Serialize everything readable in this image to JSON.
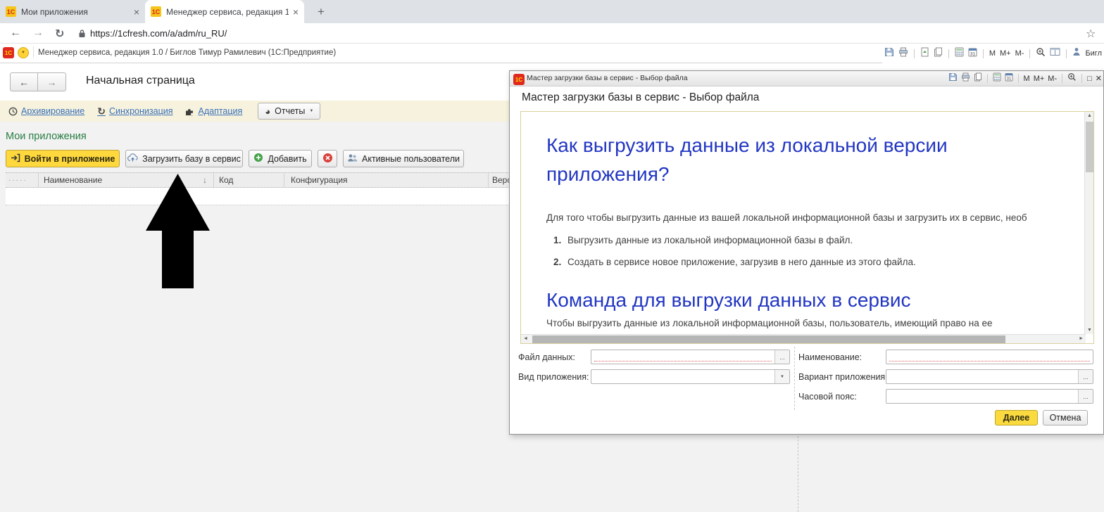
{
  "browser": {
    "tab1": "Мои приложения",
    "tab2": "Менеджер сервиса, редакция 1",
    "url": "https://1cfresh.com/a/adm/ru_RU/"
  },
  "app_bar": {
    "title": "Менеджер сервиса, редакция 1.0 / Биглов Тимур Рамилевич (1С:Предприятие)",
    "user": "Бигл"
  },
  "main": {
    "page_title": "Начальная страница",
    "link_archive": "Архивирование",
    "link_sync": "Синхронизация",
    "link_adapt": "Адаптация",
    "reports": "Отчеты",
    "section": "Мои приложения",
    "btn_enter": "Войти в приложение",
    "btn_upload": "Загрузить базу в сервис",
    "btn_add": "Добавить",
    "btn_users": "Активные пользователи",
    "col_dots": "·····",
    "col_name": "Наименование",
    "col_code": "Код",
    "col_config": "Конфигурация",
    "col_version": "Верс"
  },
  "dialog": {
    "window_title": "Мастер загрузки базы в сервис - Выбор файла",
    "heading": "Мастер загрузки базы в сервис - Выбор файла",
    "h1a": "Как выгрузить данные из локальной версии приложения?",
    "p1": "Для того чтобы выгрузить данные из вашей локальной информационной базы и загрузить их в сервис, необ",
    "li1_num": "1.",
    "li1": "Выгрузить данные из локальной информационной базы в файл.",
    "li2_num": "2.",
    "li2": "Создать в сервисе новое приложение, загрузив в него данные из этого файла.",
    "h1b": "Команда для выгрузки данных в сервис",
    "p2": "Чтобы выгрузить данные из локальной информационной базы, пользователь, имеющий право на ее",
    "lbl_file": "Файл данных:",
    "lbl_kind": "Вид приложения:",
    "lbl_name": "Наименование:",
    "lbl_variant": "Вариант приложения:",
    "lbl_tz": "Часовой пояс:",
    "btn_next": "Далее",
    "btn_cancel": "Отмена",
    "ellipsis": "..."
  },
  "icons": {
    "favicon_text": "1С",
    "back": "←",
    "forward": "→",
    "reload": "↻",
    "star": "☆",
    "new_tab": "+",
    "close_tab": "×",
    "menu_caret": "▼",
    "dropdown": "▼",
    "sort_down": "↓",
    "pie": "◕",
    "m": "M",
    "m_plus": "M+",
    "m_minus": "M-",
    "maximize": "□",
    "close": "✕",
    "scroll_up": "▲",
    "scroll_down": "▼",
    "scroll_left": "◄",
    "scroll_right": "►",
    "calendar_day": "31"
  },
  "colors": {
    "accent_yellow": "#ffd83d",
    "heading_blue": "#2236c2",
    "link_blue": "#3a70b9",
    "section_green": "#277c43",
    "required_red": "#e05b5b",
    "tabbar_gray": "#dee1e6",
    "toolbar_cream": "#f6f2dd"
  }
}
